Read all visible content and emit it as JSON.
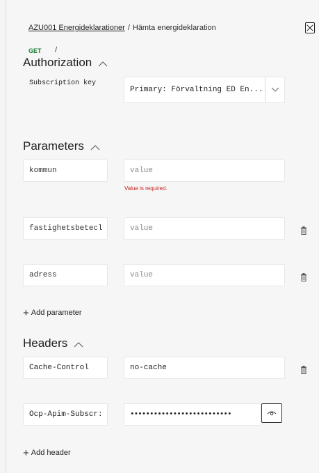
{
  "breadcrumb": {
    "api": "AZU001 Energideklarationer",
    "separator": "/",
    "operation": "Hämta energideklaration"
  },
  "request": {
    "method": "GET",
    "path": "/"
  },
  "authorization": {
    "title": "Authorization",
    "subscription_label": "Subscription key",
    "subscription_value": "Primary: Förvaltning ED En..."
  },
  "parameters": {
    "title": "Parameters",
    "items": [
      {
        "name": "kommun",
        "placeholder": "value",
        "error": "Value is required."
      },
      {
        "name": "fastighetsbetecl",
        "placeholder": "value"
      },
      {
        "name": "adress",
        "placeholder": "value"
      }
    ],
    "add_label": "Add parameter"
  },
  "headers": {
    "title": "Headers",
    "items": [
      {
        "name": "Cache-Control",
        "value": "no-cache"
      },
      {
        "name": "Ocp-Apim-Subscr:",
        "value": "••••••••••••••••••••••••••"
      }
    ],
    "add_label": "Add header"
  },
  "colors": {
    "get_method": "#1a7f37",
    "error": "#c5221f"
  }
}
